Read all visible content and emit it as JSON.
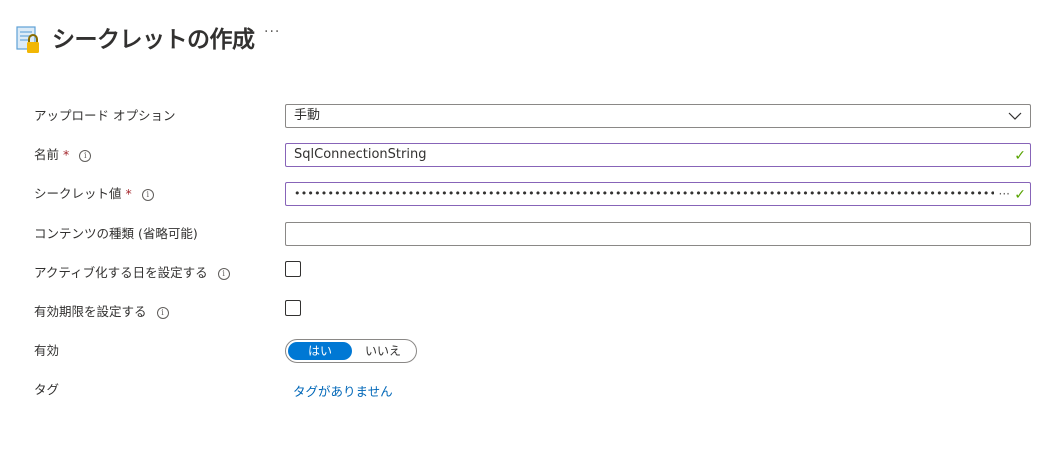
{
  "header": {
    "title": "シークレットの作成",
    "more": "···",
    "icon": "key-vault-secret-icon"
  },
  "form": {
    "upload": {
      "label": "アップロード オプション",
      "value": "手動"
    },
    "name": {
      "label": "名前",
      "required": "*",
      "info": "i",
      "value": "SqlConnectionString"
    },
    "secret": {
      "label": "シークレット値",
      "required": "*",
      "info": "i",
      "value": "•••••••••••••••••••••••••••••••••••••••••••••••••••••••••••••••••••••••••••••••••••••••••••••••••••••••••",
      "ellipsis": "···"
    },
    "content_type": {
      "label": "コンテンツの種類 (省略可能)",
      "value": ""
    },
    "activation": {
      "label": "アクティブ化する日を設定する",
      "info": "i",
      "checked": false
    },
    "expiration": {
      "label": "有効期限を設定する",
      "info": "i",
      "checked": false
    },
    "enabled": {
      "label": "有効",
      "on_label": "はい",
      "off_label": "いいえ",
      "selected": "はい"
    },
    "tags": {
      "label": "タグ",
      "link": "タグがありません"
    }
  },
  "colors": {
    "accent": "#0078d4",
    "valid_border": "#8764b8",
    "valid_check": "#57a300",
    "required": "#a4262c",
    "link": "#0067b8"
  }
}
